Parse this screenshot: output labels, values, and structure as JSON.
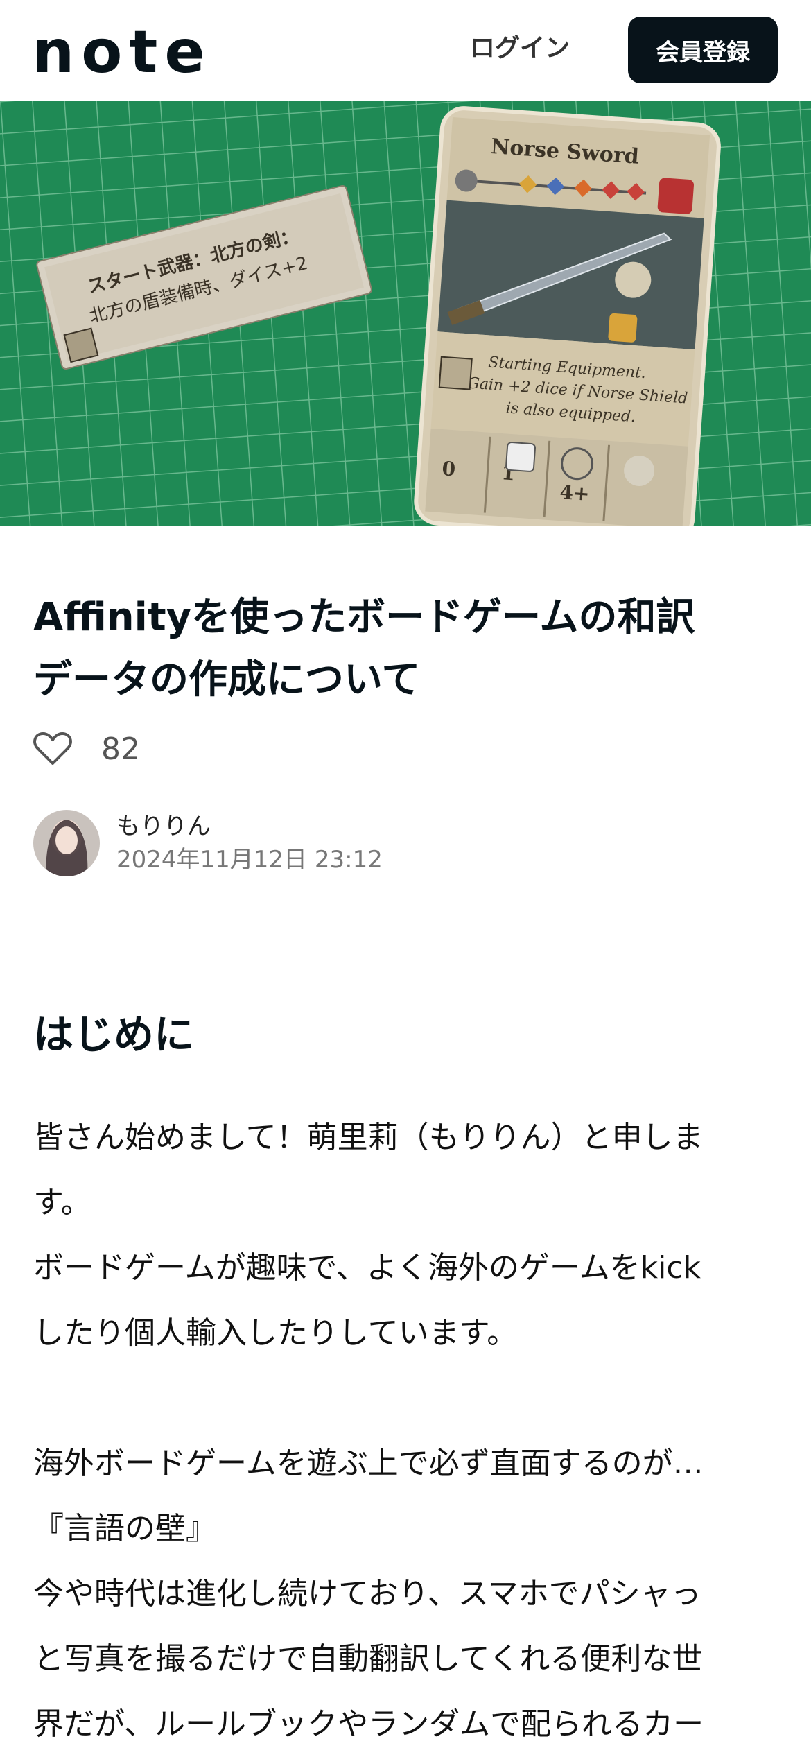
{
  "header": {
    "logo": "note",
    "login": "ログイン",
    "signup": "会員登録"
  },
  "hero": {
    "small_card_line1": "スタート武器：北方の剣：",
    "small_card_line2": "北方の盾装備時、ダイス+2",
    "card_title": "Norse Sword",
    "card_text_1": "Starting Equipment.",
    "card_text_2": "Gain +2 dice if Norse Shield",
    "card_text_3": "is also equipped.",
    "card_nums": [
      "0",
      "1",
      "4+"
    ]
  },
  "article": {
    "title_line1": "Affinityを使ったボードゲームの和訳",
    "title_line2": "データの作成について",
    "likes": "82",
    "author_name": "もりりん",
    "date": "2024年11月12日 23:12",
    "section_heading": "はじめに",
    "lines": [
      "皆さん始めまして！萌里莉（もりりん）と申しま",
      "す。",
      "ボードゲームが趣味で、よく海外のゲームをkick",
      "したり個人輸入したりしています。",
      "",
      "海外ボードゲームを遊ぶ上で必ず直面するのが…",
      "『言語の壁』",
      "今や時代は進化し続けており、スマホでパシャっ",
      "と写真を撮るだけで自動翻訳してくれる便利な世",
      "界だが、ルールブックやランダムで配られるカー"
    ]
  },
  "colors": {
    "accent": "#08131a",
    "mat_green": "#1f8a55",
    "card_beige": "#d8cdb4"
  }
}
